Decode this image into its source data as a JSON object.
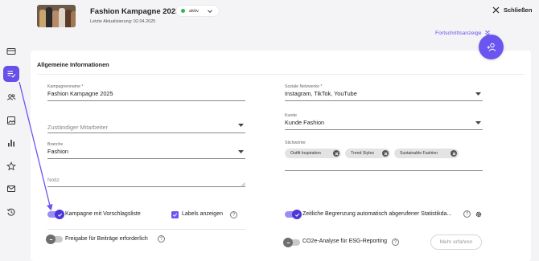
{
  "header": {
    "title": "Fashion Kampagne 2025",
    "updated": "Letzte Aktualisierung: 02.04.2025",
    "status": "aktiv",
    "close_label": "Schließen",
    "progress_label": "Fortschrittsanzeige"
  },
  "sidebar": {
    "items": [
      {
        "icon": "card-icon"
      },
      {
        "icon": "checklist-icon",
        "active": true
      },
      {
        "icon": "users-icon"
      },
      {
        "icon": "image-icon"
      },
      {
        "icon": "bar-chart-icon"
      },
      {
        "icon": "star-icon"
      },
      {
        "icon": "mail-icon"
      },
      {
        "icon": "history-icon"
      }
    ]
  },
  "section": {
    "title": "Allgemeine Informationen"
  },
  "form": {
    "campaign_name": {
      "label": "Kampagnenname *",
      "value": "Fashion Kampagne 2025"
    },
    "social_networks": {
      "label": "Soziale Netzwerke *",
      "value": "Instagram, TikTok, YouTube"
    },
    "employee": {
      "placeholder": "Zuständiger Mitarbeiter"
    },
    "customer": {
      "label": "Kunde",
      "value": "Kunde Fashion"
    },
    "industry": {
      "label": "Branche",
      "value": "Fashion"
    },
    "keywords": {
      "label": "Stichwörter",
      "chips": [
        "Outfit Inspiration",
        "Trend Styles",
        "Sustainable Fashion"
      ]
    },
    "note": {
      "placeholder": "Notiz"
    }
  },
  "options": {
    "suggestion_list": "Kampagne mit Vorschlagsliste",
    "show_labels": "Labels anzeigen",
    "time_limit": "Zeitliche Begrenzung automatisch abgerufener Statistikda...",
    "approval": "Freigabe für Beiträge erforderlich",
    "co2": "CO2e-Analyse für ESG-Reporting",
    "more_button": "Mehr erfahren",
    "help_glyph": "?"
  },
  "colors": {
    "accent": "#6650e8",
    "status_green": "#2fb84f"
  }
}
